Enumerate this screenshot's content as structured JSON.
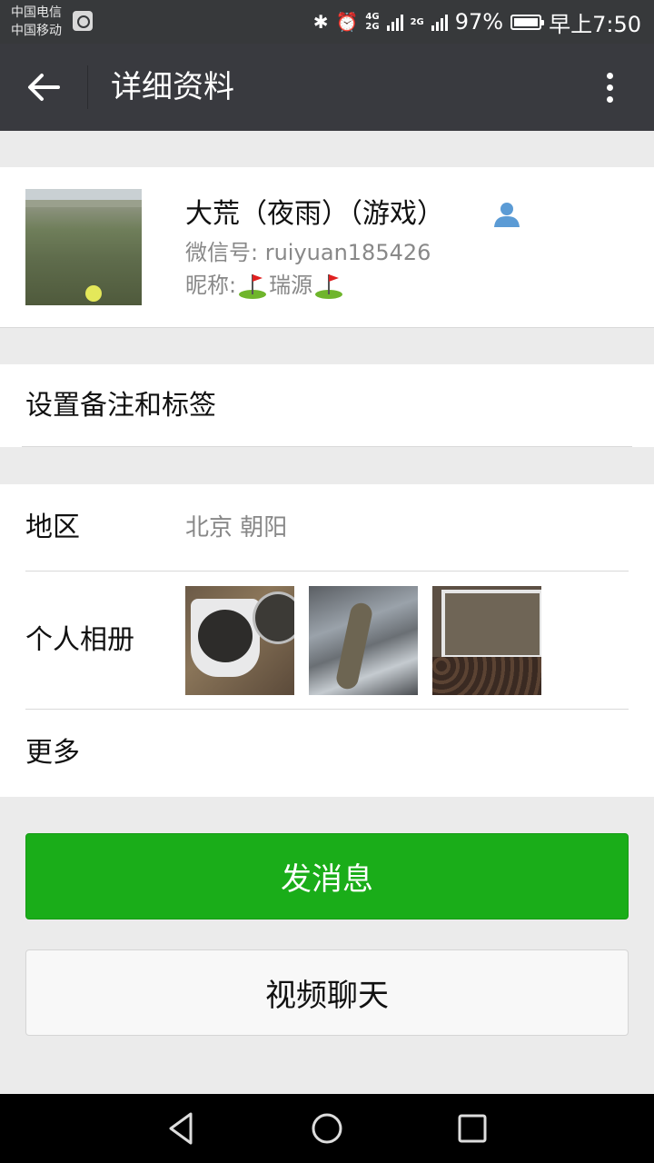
{
  "status_bar": {
    "carrier_1": "中国电信",
    "carrier_2": "中国移动",
    "network_top": "4G",
    "network_bottom": "2G",
    "network_2": "2G",
    "battery": "97%",
    "time": "早上7:50"
  },
  "header": {
    "title": "详细资料"
  },
  "profile": {
    "display_name": "大荒（夜雨）（游戏）",
    "wechat_id": "微信号: ruiyuan185426",
    "nickname_prefix": "昵称: ",
    "nickname": "瑞源"
  },
  "remark": {
    "label": "设置备注和标签"
  },
  "info": {
    "region_label": "地区",
    "region_value": "北京  朝阳",
    "album_label": "个人相册",
    "more_label": "更多"
  },
  "actions": {
    "send_message": "发消息",
    "video_chat": "视频聊天"
  },
  "colors": {
    "titlebar": "#393a3f",
    "accent_green": "#1aad19",
    "background": "#ebebeb"
  }
}
